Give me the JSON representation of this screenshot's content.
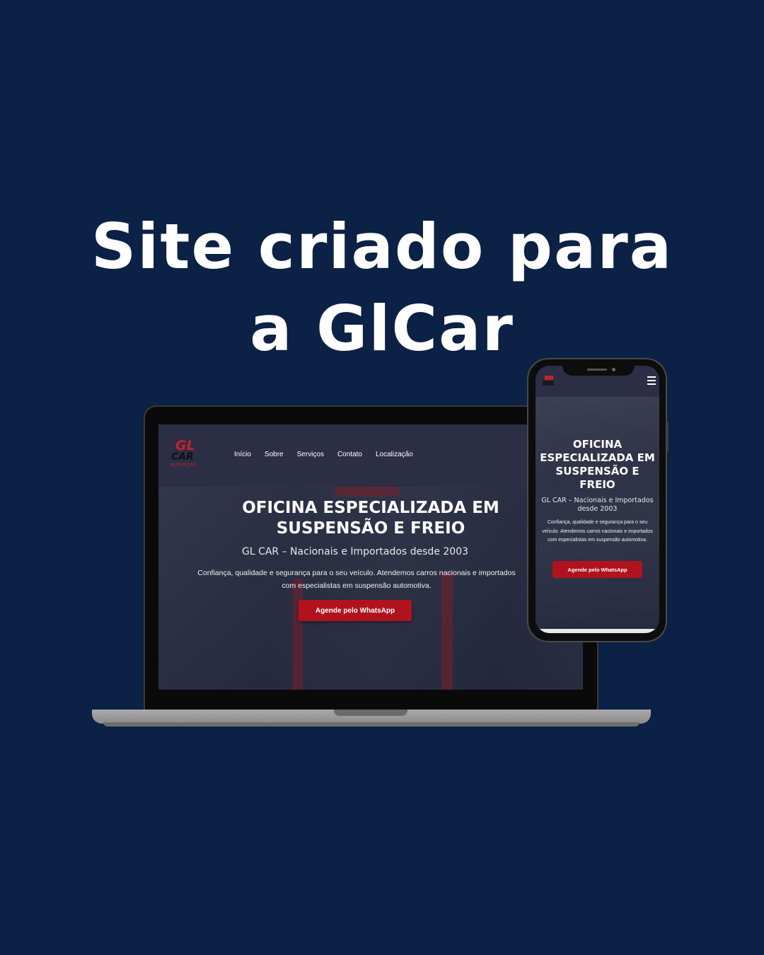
{
  "headline": {
    "line1": "Site criado para",
    "line2": "a GlCar"
  },
  "site": {
    "logo": {
      "line1": "GL",
      "line2": "CAR",
      "line3": "AUTOPEÇAS"
    },
    "nav": [
      "Início",
      "Sobre",
      "Serviços",
      "Contato",
      "Localização"
    ],
    "hero_title_line1": "OFICINA ESPECIALIZADA EM",
    "hero_title_line2": "SUSPENSÃO E FREIO",
    "subtitle": "GL CAR – Nacionais e Importados desde 2003",
    "body_line1": "Confiança, qualidade e segurança para o seu veículo. Atendemos carros nacionais e importados",
    "body_line2": "com especialistas em suspensão automotiva.",
    "cta": "Agende pelo WhatsApp"
  },
  "mobile": {
    "title_line1": "OFICINA",
    "title_line2": "ESPECIALIZADA EM",
    "title_line3": "SUSPENSÃO E",
    "title_line4": "FREIO",
    "subtitle": "GL CAR – Nacionais e Importados desde 2003",
    "body": "Confiança, qualidade e segurança para o seu veículo. Atendemos carros nacionais e importados com especialistas em suspensão automotiva.",
    "cta": "Agende pelo WhatsApp",
    "menu_icon": "hamburger-menu-icon"
  },
  "colors": {
    "background": "#0b2145",
    "cta": "#b1131e",
    "nav": "#2b2e45"
  }
}
